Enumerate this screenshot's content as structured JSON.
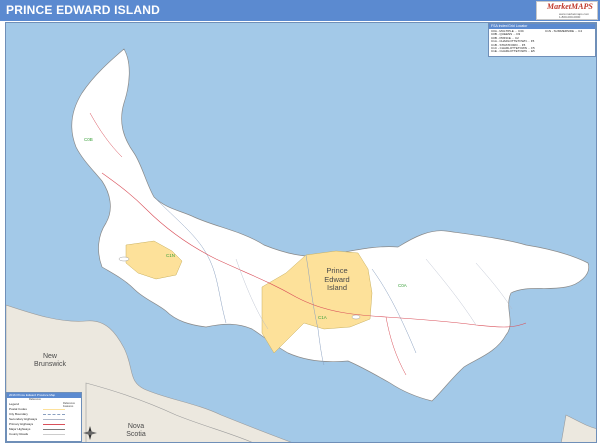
{
  "header": {
    "title": "PRINCE EDWARD ISLAND",
    "background": "#5b8ad0"
  },
  "logo": {
    "name": "MarketMAPS",
    "line1": "www.marketmaps.com",
    "line2": "1-800-000-0000"
  },
  "map": {
    "water_color": "#a3c9e8",
    "land_color": "#ffffff",
    "mainland_color": "#ece8df",
    "highlight_color": "#fde19a",
    "labels": {
      "province_line1": "Prince",
      "province_line2": "Edward",
      "province_line3": "Island",
      "new_brunswick_line1": "New",
      "new_brunswick_line2": "Brunswick",
      "nova_scotia_line1": "Nova",
      "nova_scotia_line2": "Scotia",
      "fsa_c0b": "C0B",
      "fsa_c1n": "C1N",
      "fsa_c1a": "C1A",
      "fsa_c0a": "C0A"
    },
    "fsa_box": {
      "title": "FSA Index/Grid Locator",
      "col1": [
        "C0A - MULTIPLE  ...  C3C",
        "C0B - QUEENS  ...  D3",
        "C0B - PRINCE  ...  C2",
        "C1A - CHARLOTTETOWN  ...  F5",
        "C1B - STRATFORD  ...  F5",
        "C1C - CHARLOTTETOWN  ...  F5",
        "C1E - CHARLOTTETOWN  ...  E5"
      ],
      "col2": [
        "C1N - SUMMERSIDE  ...  C4"
      ]
    },
    "legend": {
      "title": "2016 Prince Edward Province Map",
      "subtitle": "Reference",
      "rows": [
        "Legend",
        "Postal Codes",
        "City Boundary",
        "Secondary Highways",
        "Primary Highways",
        "Major Highways",
        "County Roads"
      ],
      "right_col_title": "Reference Features"
    }
  }
}
